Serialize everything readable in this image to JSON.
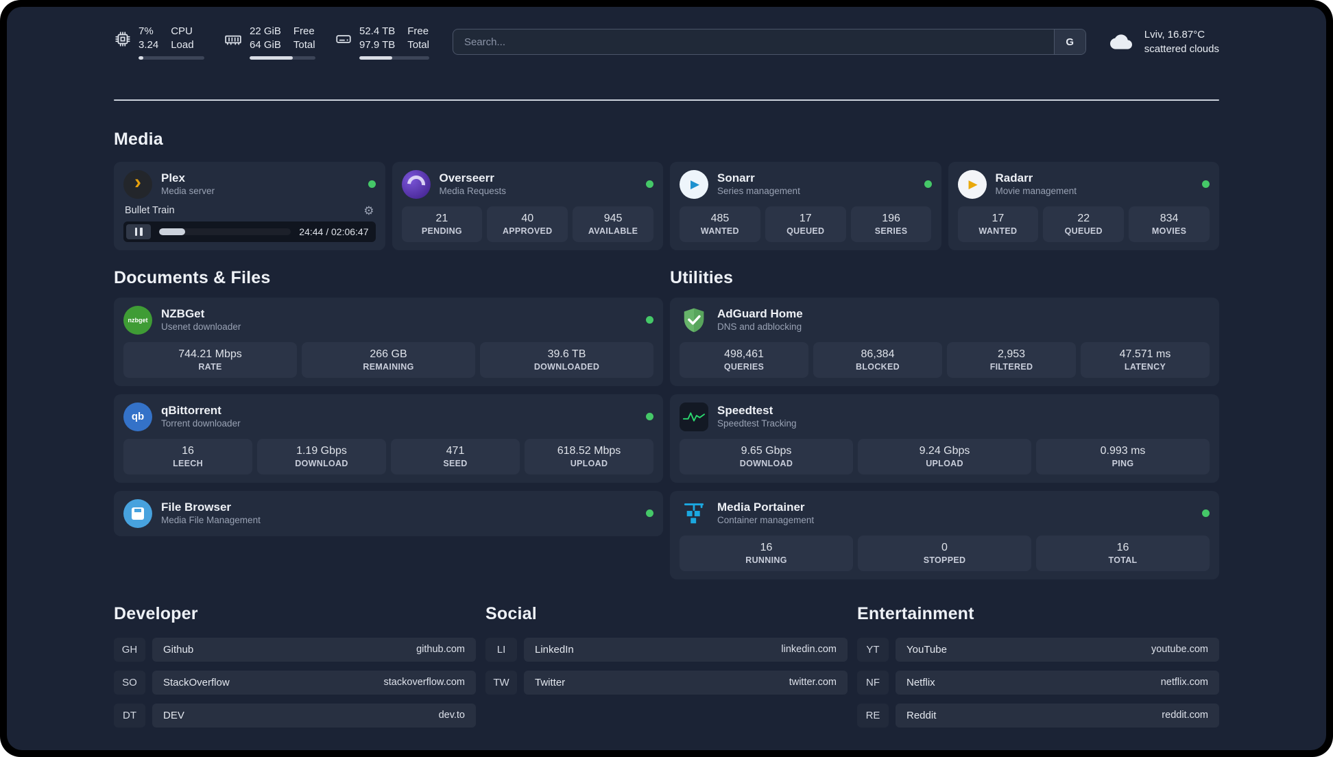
{
  "topbar": {
    "cpu": {
      "value": "7%",
      "sub": "3.24",
      "label_top": "CPU",
      "label_bottom": "Load",
      "fill": 7
    },
    "ram": {
      "value": "22 GiB",
      "sub": "64 GiB",
      "label_top": "Free",
      "label_bottom": "Total",
      "fill": 66
    },
    "disk": {
      "value": "52.4 TB",
      "sub": "97.9 TB",
      "label_top": "Free",
      "label_bottom": "Total",
      "fill": 47
    },
    "search": {
      "placeholder": "Search...",
      "provider": "G"
    },
    "weather": {
      "location": "Lviv, 16.87°C",
      "condition": "scattered clouds"
    }
  },
  "icons": {
    "plex_glyph": "›",
    "sonarr_glyph": "▶",
    "radarr_glyph": "▶",
    "nzbget_label": "nzbget",
    "qbittorrent_label": "qb",
    "gear_glyph": "⚙"
  },
  "colors": {
    "status_online": "#45c868",
    "adguard_green": "#67b46a",
    "speedtest_line": "#2bd96f",
    "portainer_blue": "#1ba8e0",
    "plex_amber": "#e5a00d"
  },
  "sections": {
    "media": {
      "title": "Media",
      "plex": {
        "name": "Plex",
        "desc": "Media server",
        "now_playing": "Bullet Train",
        "time": "24:44 / 02:06:47",
        "progress": 20
      },
      "overseerr": {
        "name": "Overseerr",
        "desc": "Media Requests",
        "stats": [
          {
            "value": "21",
            "label": "PENDING"
          },
          {
            "value": "40",
            "label": "APPROVED"
          },
          {
            "value": "945",
            "label": "AVAILABLE"
          }
        ]
      },
      "sonarr": {
        "name": "Sonarr",
        "desc": "Series management",
        "stats": [
          {
            "value": "485",
            "label": "WANTED"
          },
          {
            "value": "17",
            "label": "QUEUED"
          },
          {
            "value": "196",
            "label": "SERIES"
          }
        ]
      },
      "radarr": {
        "name": "Radarr",
        "desc": "Movie management",
        "stats": [
          {
            "value": "17",
            "label": "WANTED"
          },
          {
            "value": "22",
            "label": "QUEUED"
          },
          {
            "value": "834",
            "label": "MOVIES"
          }
        ]
      }
    },
    "documents": {
      "title": "Documents & Files",
      "nzbget": {
        "name": "NZBGet",
        "desc": "Usenet downloader",
        "stats": [
          {
            "value": "744.21 Mbps",
            "label": "RATE"
          },
          {
            "value": "266 GB",
            "label": "REMAINING"
          },
          {
            "value": "39.6 TB",
            "label": "DOWNLOADED"
          }
        ]
      },
      "qbittorrent": {
        "name": "qBittorrent",
        "desc": "Torrent downloader",
        "stats": [
          {
            "value": "16",
            "label": "LEECH"
          },
          {
            "value": "1.19 Gbps",
            "label": "DOWNLOAD"
          },
          {
            "value": "471",
            "label": "SEED"
          },
          {
            "value": "618.52 Mbps",
            "label": "UPLOAD"
          }
        ]
      },
      "filebrowser": {
        "name": "File Browser",
        "desc": "Media File Management"
      }
    },
    "utilities": {
      "title": "Utilities",
      "adguard": {
        "name": "AdGuard Home",
        "desc": "DNS and adblocking",
        "stats": [
          {
            "value": "498,461",
            "label": "QUERIES"
          },
          {
            "value": "86,384",
            "label": "BLOCKED"
          },
          {
            "value": "2,953",
            "label": "FILTERED"
          },
          {
            "value": "47.571 ms",
            "label": "LATENCY"
          }
        ]
      },
      "speedtest": {
        "name": "Speedtest",
        "desc": "Speedtest Tracking",
        "stats": [
          {
            "value": "9.65 Gbps",
            "label": "DOWNLOAD"
          },
          {
            "value": "9.24 Gbps",
            "label": "UPLOAD"
          },
          {
            "value": "0.993 ms",
            "label": "PING"
          }
        ]
      },
      "portainer": {
        "name": "Media Portainer",
        "desc": "Container management",
        "stats": [
          {
            "value": "16",
            "label": "RUNNING"
          },
          {
            "value": "0",
            "label": "STOPPED"
          },
          {
            "value": "16",
            "label": "TOTAL"
          }
        ]
      }
    },
    "developer": {
      "title": "Developer",
      "links": [
        {
          "abbr": "GH",
          "name": "Github",
          "url": "github.com"
        },
        {
          "abbr": "SO",
          "name": "StackOverflow",
          "url": "stackoverflow.com"
        },
        {
          "abbr": "DT",
          "name": "DEV",
          "url": "dev.to"
        }
      ]
    },
    "social": {
      "title": "Social",
      "links": [
        {
          "abbr": "LI",
          "name": "LinkedIn",
          "url": "linkedin.com"
        },
        {
          "abbr": "TW",
          "name": "Twitter",
          "url": "twitter.com"
        }
      ]
    },
    "entertainment": {
      "title": "Entertainment",
      "links": [
        {
          "abbr": "YT",
          "name": "YouTube",
          "url": "youtube.com"
        },
        {
          "abbr": "NF",
          "name": "Netflix",
          "url": "netflix.com"
        },
        {
          "abbr": "RE",
          "name": "Reddit",
          "url": "reddit.com"
        }
      ]
    }
  }
}
